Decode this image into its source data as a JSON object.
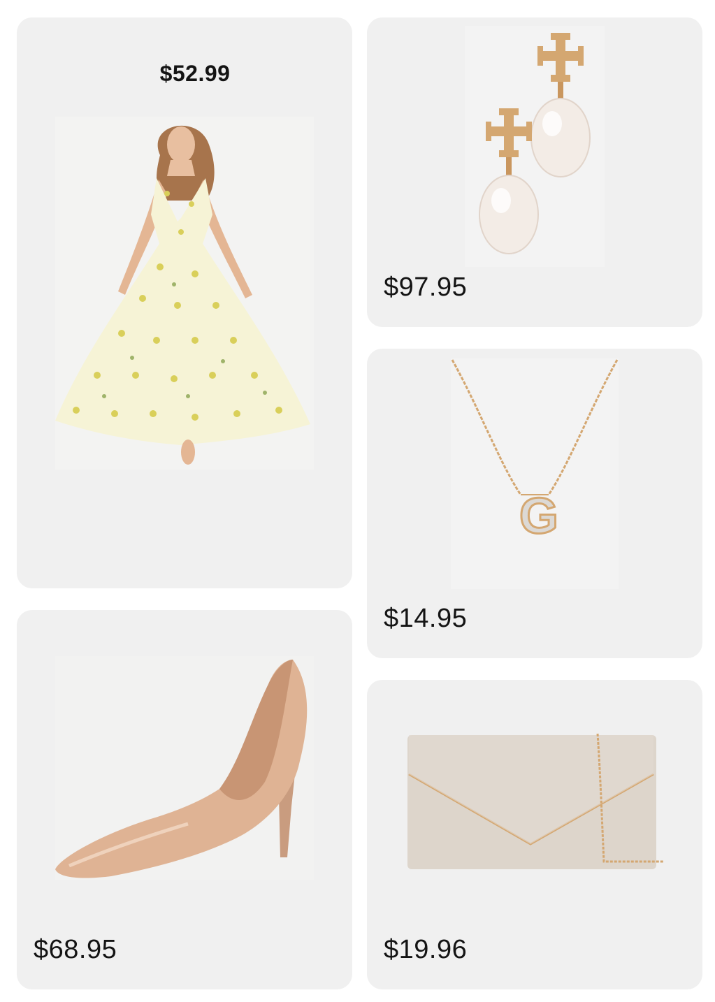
{
  "products": [
    {
      "name": "Floral halter maxi dress",
      "price": "$52.99"
    },
    {
      "name": "Pearl drop logo earrings",
      "price": "$97.95"
    },
    {
      "name": "Initial G pendant necklace",
      "price": "$14.95"
    },
    {
      "name": "Nude patent pointed-toe pump",
      "price": "$68.95"
    },
    {
      "name": "Envelope clutch with chain",
      "price": "$19.96"
    }
  ],
  "colors": {
    "card_bg": "#f0f0f0",
    "dress_fabric": "#f6f3d6",
    "dress_flower": "#d9cf5a",
    "gold": "#d4a771",
    "pearl": "#f3ece6",
    "pump": "#dfb394",
    "clutch": "#ddd5cb"
  },
  "necklace_letter": "G"
}
